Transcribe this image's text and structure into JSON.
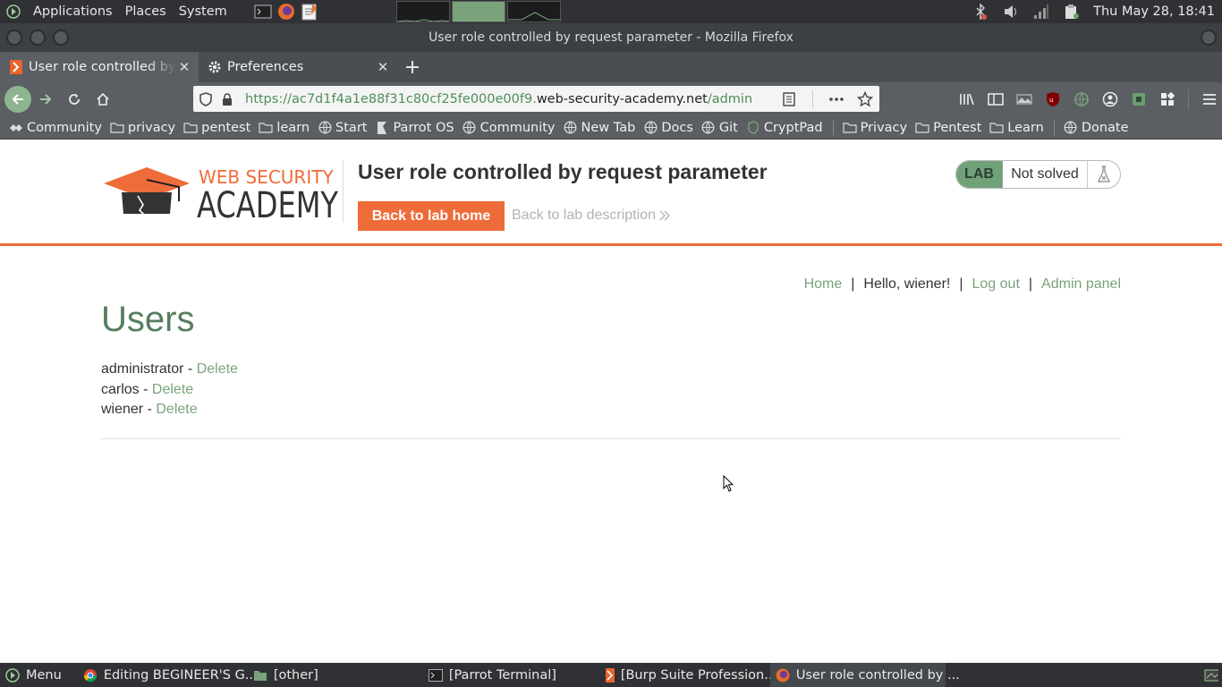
{
  "top_panel": {
    "menus": [
      "Applications",
      "Places",
      "System"
    ],
    "clock": "Thu May 28, 18:41"
  },
  "window": {
    "title": "User role controlled by request parameter - Mozilla Firefox"
  },
  "tabs": [
    {
      "label": "User role controlled by request parameter",
      "icon": "portswigger-icon"
    },
    {
      "label": "Preferences",
      "icon": "gear-icon"
    }
  ],
  "url": {
    "prefix": "https://ac7d1f4a1e88f31c80cf25fe000e00f9.",
    "host": "web-security-academy.net",
    "path": "/admin"
  },
  "bookmarks": [
    {
      "label": "Community",
      "icon": "community-icon"
    },
    {
      "label": "privacy",
      "icon": "folder-icon"
    },
    {
      "label": "pentest",
      "icon": "folder-icon"
    },
    {
      "label": "learn",
      "icon": "folder-icon"
    },
    {
      "label": "Start",
      "icon": "globe-icon"
    },
    {
      "label": "Parrot OS",
      "icon": "parrot-icon"
    },
    {
      "label": "Community",
      "icon": "globe-icon"
    },
    {
      "label": "New Tab",
      "icon": "globe-icon"
    },
    {
      "label": "Docs",
      "icon": "globe-icon"
    },
    {
      "label": "Git",
      "icon": "globe-icon"
    },
    {
      "label": "CryptPad",
      "icon": "shield-icon"
    },
    {
      "label": "Privacy",
      "icon": "folder-icon"
    },
    {
      "label": "Pentest",
      "icon": "folder-icon"
    },
    {
      "label": "Learn",
      "icon": "folder-icon"
    },
    {
      "label": "Donate",
      "icon": "globe-icon"
    }
  ],
  "lab": {
    "logo_line1": "WEB SECURITY",
    "logo_line2": "ACADEMY",
    "title": "User role controlled by request parameter",
    "back_home_label": "Back to lab home",
    "back_desc_label": "Back to lab description",
    "status_badge": "LAB",
    "status_text": "Not solved"
  },
  "account_nav": {
    "home": "Home",
    "greeting": "Hello, wiener!",
    "logout": "Log out",
    "admin": "Admin panel",
    "separator": "|"
  },
  "users": {
    "heading": "Users",
    "list": [
      {
        "name": "administrator",
        "action": "Delete"
      },
      {
        "name": "carlos",
        "action": "Delete"
      },
      {
        "name": "wiener",
        "action": "Delete"
      }
    ],
    "separator": " - "
  },
  "taskbar": {
    "menu_label": "Menu",
    "tasks": [
      {
        "label": "Editing BEGINEER'S G...",
        "icon": "chrome-icon"
      },
      {
        "label": "[other]",
        "icon": "folder-icon"
      },
      {
        "label": "[Parrot Terminal]",
        "icon": "terminal-icon"
      },
      {
        "label": "[Burp Suite Profession...",
        "icon": "burp-icon"
      },
      {
        "label": "User role controlled by ...",
        "icon": "firefox-icon"
      }
    ]
  },
  "colors": {
    "accent_orange": "#ee6c3a",
    "link_green": "#7aa37c",
    "heading_green": "#567d5e"
  }
}
